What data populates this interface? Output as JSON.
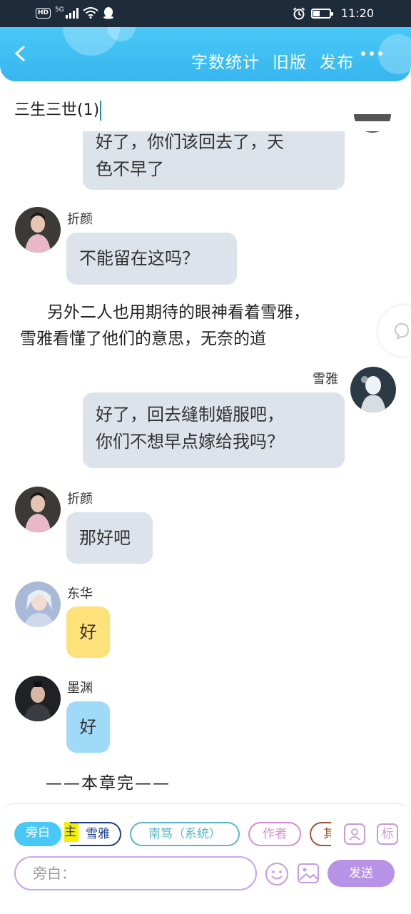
{
  "status_bar": {
    "network": "5G",
    "hd_label": "HD",
    "time": "11:20"
  },
  "header": {
    "actions": [
      "字数统计",
      "旧版",
      "发布"
    ]
  },
  "chapter_title": "三生三世(1)",
  "messages": [
    {
      "speaker": "",
      "text_lines": [
        "好了，你们该回去了，天",
        "色不早了"
      ]
    },
    {
      "speaker": "折颜",
      "text_lines": [
        "不能留在这吗？"
      ]
    },
    {
      "speaker": "雪雅",
      "text_lines": [
        "好了，回去缝制婚服吧，",
        "你们不想早点嫁给我吗？"
      ]
    },
    {
      "speaker": "折颜",
      "text_lines": [
        "那好吧"
      ]
    },
    {
      "speaker": "东华",
      "text_lines": [
        "好"
      ]
    },
    {
      "speaker": "墨渊",
      "text_lines": [
        "好"
      ]
    }
  ],
  "narration_lines": [
    "另外二人也用期待的眼神看着雪雅，",
    "雪雅看懂了他们的意思，无奈的道"
  ],
  "chapter_end": "——本章完——",
  "composer": {
    "roles": [
      "旁白",
      "主",
      "雪雅",
      "南笃（系统）",
      "作者",
      "其"
    ],
    "placeholder": "旁白：",
    "send_label": "发送",
    "tag_icon_label": "标"
  },
  "colors": {
    "header": "#3ab8f2",
    "bubble": "#dde3ea",
    "yellow_bubble": "#fde27a",
    "blue_bubble": "#9fdaf8",
    "send": "#b892e6"
  }
}
